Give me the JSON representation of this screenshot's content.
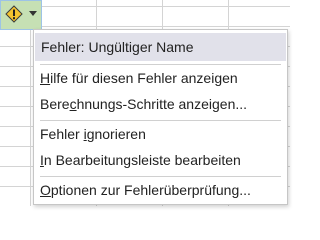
{
  "smart_tag": {
    "icon": "warning-diamond-icon",
    "accent": "#f4c430"
  },
  "menu": {
    "header": "Fehler: Ungültiger Name",
    "items": [
      {
        "pre": "",
        "key": "H",
        "post": "ilfe für diesen Fehler anzeigen"
      },
      {
        "pre": "Bere",
        "key": "c",
        "post": "hnungs-Schritte anzeigen..."
      },
      {
        "pre": "Fehler ",
        "key": "i",
        "post": "gnorieren"
      },
      {
        "pre": "",
        "key": "I",
        "post": "n Bearbeitungsleiste bearbeiten"
      },
      {
        "pre": "",
        "key": "O",
        "post": "ptionen zur Fehlerüberprüfung..."
      }
    ]
  }
}
